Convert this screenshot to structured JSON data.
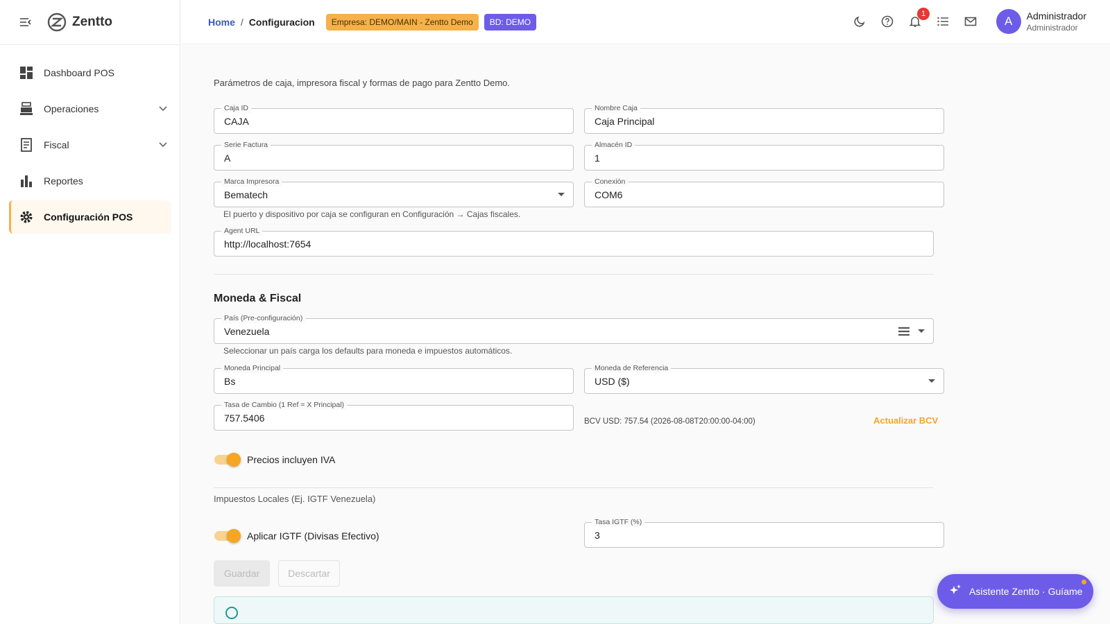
{
  "sidebar": {
    "logo_text": "Zentto",
    "items": [
      {
        "label": "Dashboard POS",
        "icon": "dashboard-icon"
      },
      {
        "label": "Operaciones",
        "icon": "register-icon"
      },
      {
        "label": "Fiscal",
        "icon": "receipt-icon"
      },
      {
        "label": "Reportes",
        "icon": "bar-chart-icon"
      },
      {
        "label": "Configuración POS",
        "icon": "gear-icon"
      }
    ]
  },
  "topbar": {
    "breadcrumb_home": "Home",
    "breadcrumb_sep": "/",
    "breadcrumb_current": "Configuracion",
    "company_chip": "Empresa: DEMO/MAIN - Zentto Demo",
    "db_chip": "BD: DEMO",
    "notifications_count": "1",
    "user_initial": "A",
    "user_name": "Administrador",
    "user_role": "Administrador"
  },
  "form": {
    "description": "Parámetros de caja, impresora fiscal y formas de pago para Zentto Demo.",
    "caja_id": {
      "label": "Caja ID",
      "value": "CAJA"
    },
    "nombre_caja": {
      "label": "Nombre Caja",
      "value": "Caja Principal"
    },
    "serie_factura": {
      "label": "Serie Factura",
      "value": "A"
    },
    "almacen_id": {
      "label": "Almacén ID",
      "value": "1"
    },
    "marca_impresora": {
      "label": "Marca Impresora",
      "value": "Bematech"
    },
    "conexion": {
      "label": "Conexión",
      "value": "COM6"
    },
    "printer_helper": "El puerto y dispositivo por caja se configuran en Configuración → Cajas fiscales.",
    "agent_url": {
      "label": "Agent URL",
      "value": "http://localhost:7654"
    },
    "section_title": "Moneda & Fiscal",
    "pais": {
      "label": "País (Pre-configuración)",
      "value": "Venezuela"
    },
    "pais_helper": "Seleccionar un país carga los defaults para moneda e impuestos automáticos.",
    "moneda_principal": {
      "label": "Moneda Principal",
      "value": "Bs"
    },
    "moneda_referencia": {
      "label": "Moneda de Referencia",
      "value": "USD ($)"
    },
    "tasa_cambio": {
      "label": "Tasa de Cambio (1 Ref = X Principal)",
      "value": "757.5406"
    },
    "bcv_info": "BCV USD: 757.54 (2026-08-08T20:00:00-04:00)",
    "bcv_button": "Actualizar BCV",
    "precios_iva_label": "Precios incluyen IVA",
    "impuestos_label": "Impuestos Locales (Ej. IGTF Venezuela)",
    "igtf_toggle_label": "Aplicar IGTF (Divisas Efectivo)",
    "tasa_igtf": {
      "label": "Tasa IGTF (%)",
      "value": "3"
    },
    "save_label": "Guardar",
    "discard_label": "Descartar"
  },
  "assistant": {
    "label": "Asistente Zentto · Guíame"
  },
  "colors": {
    "accent": "#f5a623",
    "brand": "#6d5ce8",
    "link": "#3a5ab8"
  }
}
